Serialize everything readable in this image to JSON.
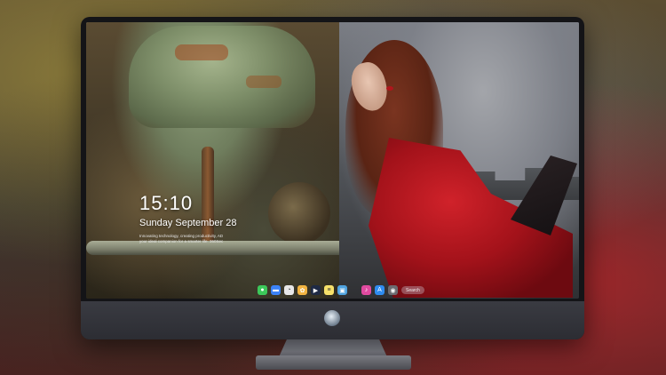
{
  "lock_screen": {
    "time": "15:10",
    "date": "Sunday September 28",
    "tagline_1": "Innovating technology, creating productivity, AD",
    "tagline_2": "your ideal companion for a smarter life. 360Sec"
  },
  "dock": {
    "icons": [
      {
        "name": "messages",
        "color": "#3cc85a",
        "glyph": "●"
      },
      {
        "name": "files",
        "color": "#3b82f6",
        "glyph": "▬"
      },
      {
        "name": "clock",
        "color": "#e8e8e8",
        "glyph": "◔"
      },
      {
        "name": "photos",
        "color": "#f2b441",
        "glyph": "✿"
      },
      {
        "name": "video",
        "color": "#1f2a44",
        "glyph": "▶"
      },
      {
        "name": "notes",
        "color": "#f7e16a",
        "glyph": "≡"
      },
      {
        "name": "gallery",
        "color": "#4fa3e0",
        "glyph": "▣"
      },
      {
        "name": "music",
        "color": "#e04aa0",
        "glyph": "♪"
      },
      {
        "name": "app-store",
        "color": "#2f8cf0",
        "glyph": "A"
      },
      {
        "name": "camera",
        "color": "#6b6b70",
        "glyph": "◉"
      }
    ],
    "search_pill": "Search"
  },
  "colors": {
    "bezel": "#141417",
    "chin": "#2c2d33",
    "dress": "#d0222a"
  }
}
